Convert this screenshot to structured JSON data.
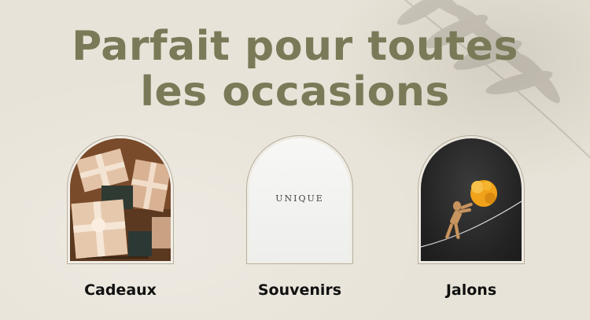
{
  "headline": {
    "line1": "Parfait pour toutes",
    "line2": "les occasions"
  },
  "cards": [
    {
      "label": "Cadeaux",
      "image": "gift-boxes-photo"
    },
    {
      "label": "Souvenirs",
      "image": "unique-stamp-card",
      "inner_text": "UNIQUE"
    },
    {
      "label": "Jalons",
      "image": "wooden-figure-pushing-ball-photo"
    }
  ],
  "colors": {
    "background": "#e8e3d8",
    "headline": "#7a7a58",
    "label": "#111111",
    "frame": "#b7ae9d"
  }
}
